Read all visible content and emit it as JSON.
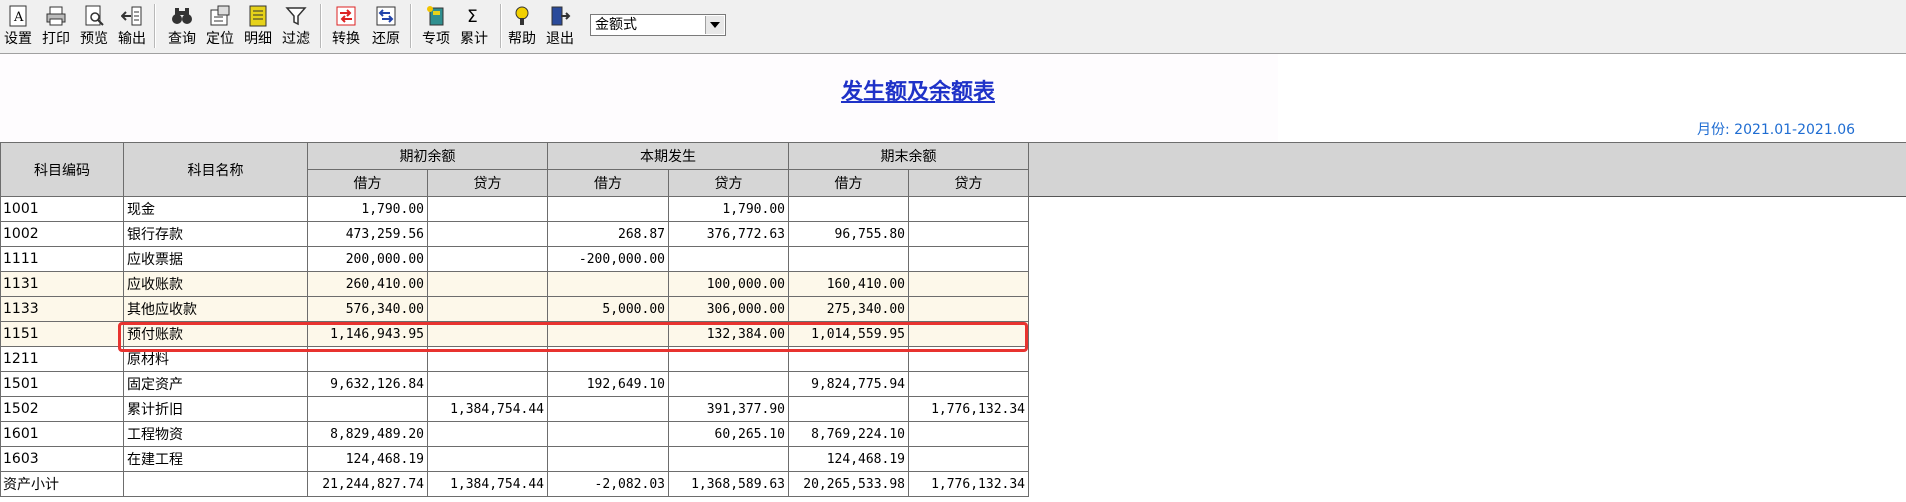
{
  "toolbar": {
    "buttons": [
      {
        "label": "设置",
        "icon": "settings-icon"
      },
      {
        "label": "打印",
        "icon": "print-icon"
      },
      {
        "label": "预览",
        "icon": "preview-icon"
      },
      {
        "label": "输出",
        "icon": "export-icon"
      },
      {
        "label": "查询",
        "icon": "binoculars-icon"
      },
      {
        "label": "定位",
        "icon": "locate-icon"
      },
      {
        "label": "明细",
        "icon": "detail-icon"
      },
      {
        "label": "过滤",
        "icon": "filter-icon"
      },
      {
        "label": "转换",
        "icon": "convert-icon"
      },
      {
        "label": "还原",
        "icon": "restore-icon"
      },
      {
        "label": "专项",
        "icon": "special-icon"
      },
      {
        "label": "累计",
        "icon": "sigma-icon"
      },
      {
        "label": "帮助",
        "icon": "help-icon"
      },
      {
        "label": "退出",
        "icon": "exit-icon"
      }
    ],
    "format_select": {
      "value": "金额式"
    }
  },
  "report": {
    "title": "发生额及余额表",
    "period": "月份: 2021.01-2021.06"
  },
  "table": {
    "headers": {
      "code": "科目编码",
      "name": "科目名称",
      "opening": "期初余额",
      "current": "本期发生",
      "closing": "期末余额",
      "debit": "借方",
      "credit": "贷方"
    },
    "rows": [
      {
        "code": "1001",
        "name": "现金",
        "open_dr": "1,790.00",
        "open_cr": "",
        "cur_dr": "",
        "cur_cr": "1,790.00",
        "close_dr": "",
        "close_cr": ""
      },
      {
        "code": "1002",
        "name": "银行存款",
        "open_dr": "473,259.56",
        "open_cr": "",
        "cur_dr": "268.87",
        "cur_cr": "376,772.63",
        "close_dr": "96,755.80",
        "close_cr": ""
      },
      {
        "code": "1111",
        "name": "应收票据",
        "open_dr": "200,000.00",
        "open_cr": "",
        "cur_dr": "-200,000.00",
        "cur_cr": "",
        "close_dr": "",
        "close_cr": ""
      },
      {
        "code": "1131",
        "name": "应收账款",
        "open_dr": "260,410.00",
        "open_cr": "",
        "cur_dr": "",
        "cur_cr": "100,000.00",
        "close_dr": "160,410.00",
        "close_cr": ""
      },
      {
        "code": "1133",
        "name": "其他应收款",
        "open_dr": "576,340.00",
        "open_cr": "",
        "cur_dr": "5,000.00",
        "cur_cr": "306,000.00",
        "close_dr": "275,340.00",
        "close_cr": ""
      },
      {
        "code": "1151",
        "name": "预付账款",
        "open_dr": "1,146,943.95",
        "open_cr": "",
        "cur_dr": "",
        "cur_cr": "132,384.00",
        "close_dr": "1,014,559.95",
        "close_cr": ""
      },
      {
        "code": "1211",
        "name": "原材料",
        "open_dr": "",
        "open_cr": "",
        "cur_dr": "",
        "cur_cr": "",
        "close_dr": "",
        "close_cr": ""
      },
      {
        "code": "1501",
        "name": "固定资产",
        "open_dr": "9,632,126.84",
        "open_cr": "",
        "cur_dr": "192,649.10",
        "cur_cr": "",
        "close_dr": "9,824,775.94",
        "close_cr": ""
      },
      {
        "code": "1502",
        "name": "累计折旧",
        "open_dr": "",
        "open_cr": "1,384,754.44",
        "cur_dr": "",
        "cur_cr": "391,377.90",
        "close_dr": "",
        "close_cr": "1,776,132.34"
      },
      {
        "code": "1601",
        "name": "工程物资",
        "open_dr": "8,829,489.20",
        "open_cr": "",
        "cur_dr": "",
        "cur_cr": "60,265.10",
        "close_dr": "8,769,224.10",
        "close_cr": ""
      },
      {
        "code": "1603",
        "name": "在建工程",
        "open_dr": "124,468.19",
        "open_cr": "",
        "cur_dr": "",
        "cur_cr": "",
        "close_dr": "124,468.19",
        "close_cr": ""
      },
      {
        "code": "资产小计",
        "name": "",
        "open_dr": "21,244,827.74",
        "open_cr": "1,384,754.44",
        "cur_dr": "-2,082.03",
        "cur_cr": "1,368,589.63",
        "close_dr": "20,265,533.98",
        "close_cr": "1,776,132.34"
      }
    ],
    "highlighted_row_code": "1151",
    "highlight_color": "#e8332f"
  }
}
